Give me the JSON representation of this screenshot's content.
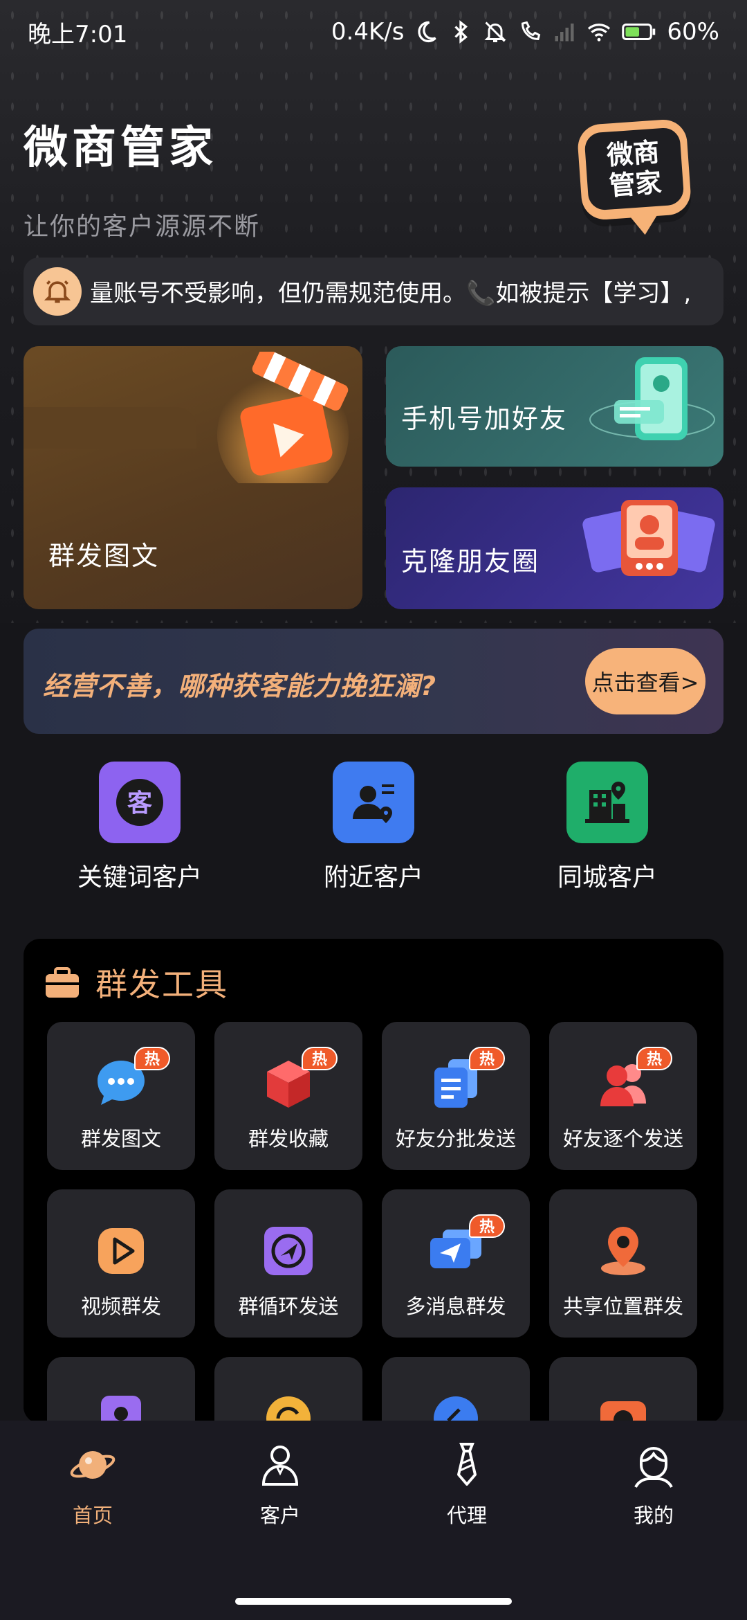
{
  "status_bar": {
    "time": "晚上7:01",
    "speed": "0.4K/s",
    "battery": "60%"
  },
  "header": {
    "title": "微商管家",
    "subtitle": "让你的客户源源不断",
    "logo_text": "微商管家"
  },
  "notice": {
    "text": "量账号不受影响，但仍需规范使用。📞如被提示【学习】,"
  },
  "feature_cards": {
    "mass_post": "群发图文",
    "phone_add": "手机号加好友",
    "clone_moments": "克隆朋友圈"
  },
  "promo": {
    "text": "经营不善，哪种获客能力挽狂澜?",
    "button": "点击查看>"
  },
  "quick_entries": [
    {
      "label": "关键词客户",
      "icon": "keyword-customer-icon",
      "color": "#8d63f0"
    },
    {
      "label": "附近客户",
      "icon": "nearby-customer-icon",
      "color": "#3f7bf0"
    },
    {
      "label": "同城客户",
      "icon": "same-city-customer-icon",
      "color": "#1fae6a"
    }
  ],
  "tools": {
    "title": "群发工具",
    "hot_label": "热",
    "items": [
      {
        "label": "群发图文",
        "hot": true
      },
      {
        "label": "群发收藏",
        "hot": true
      },
      {
        "label": "好友分批发送",
        "hot": true
      },
      {
        "label": "好友逐个发送",
        "hot": true
      },
      {
        "label": "视频群发",
        "hot": false
      },
      {
        "label": "群循环发送",
        "hot": false
      },
      {
        "label": "多消息群发",
        "hot": true
      },
      {
        "label": "共享位置群发",
        "hot": false
      }
    ]
  },
  "bottom_nav": [
    {
      "label": "首页",
      "active": true
    },
    {
      "label": "客户",
      "active": false
    },
    {
      "label": "代理",
      "active": false
    },
    {
      "label": "我的",
      "active": false
    }
  ],
  "colors": {
    "accent": "#f3b07a",
    "hot_badge": "#ef5a2a"
  }
}
